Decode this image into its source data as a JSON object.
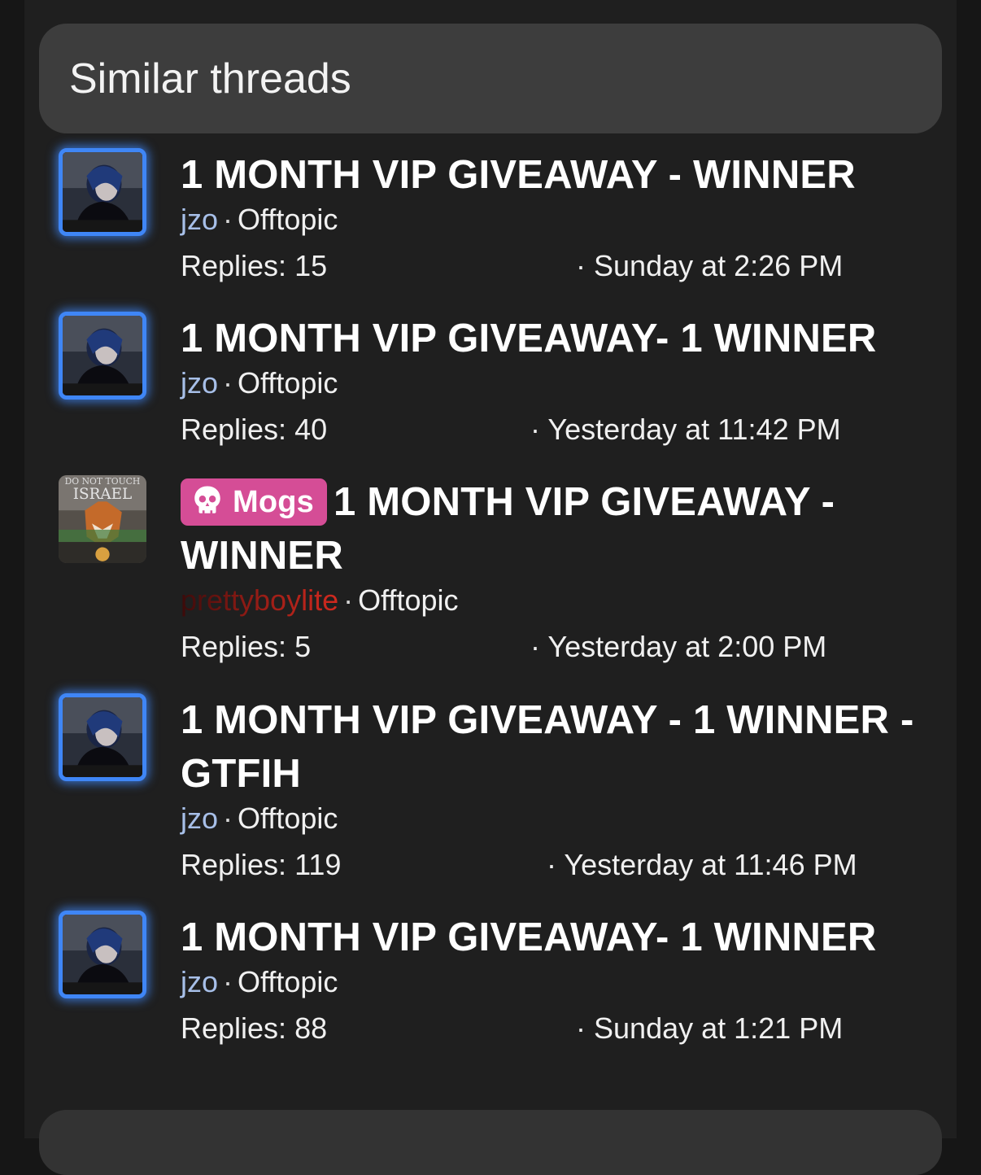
{
  "section": {
    "title": "Similar threads"
  },
  "threads": [
    {
      "title": "1 MONTH VIP GIVEAWAY - WINNER",
      "user": "jzo",
      "forum": "Offtopic",
      "replies_label": "Replies: 15",
      "date": "Sunday at 2:26 PM",
      "avatar_icon": "user-avatar-icon"
    },
    {
      "title": "1 MONTH VIP GIVEAWAY- 1 WINNER",
      "user": "jzo",
      "forum": "Offtopic",
      "replies_label": "Replies: 40",
      "date": "Yesterday at 11:42 PM",
      "avatar_icon": "user-avatar-icon"
    },
    {
      "prefix": "Mogs",
      "prefix_icon": "skull-icon",
      "title": "1 MONTH VIP GIVEAWAY - WINNER",
      "user": "prettyboylite",
      "forum": "Offtopic",
      "replies_label": "Replies: 5",
      "date": "Yesterday at 2:00 PM",
      "avatar_icon": "user-avatar-icon",
      "avatar_text": [
        "DO NOT TOUCH",
        "ISRAEL"
      ]
    },
    {
      "title": "1 MONTH VIP GIVEAWAY - 1 WINNER - GTFIH",
      "user": "jzo",
      "forum": "Offtopic",
      "replies_label": "Replies: 119",
      "date": "Yesterday at 11:46 PM",
      "avatar_icon": "user-avatar-icon"
    },
    {
      "title": "1 MONTH VIP GIVEAWAY- 1 WINNER",
      "user": "jzo",
      "forum": "Offtopic",
      "replies_label": "Replies: 88",
      "date": "Sunday at 1:21 PM",
      "avatar_icon": "user-avatar-icon"
    }
  ],
  "separator": "·",
  "colors": {
    "accent_glow": "#3f86f6",
    "prefix_badge": "#d54d96",
    "username": "#a7bfe8",
    "username_red": "#d32a1f"
  }
}
